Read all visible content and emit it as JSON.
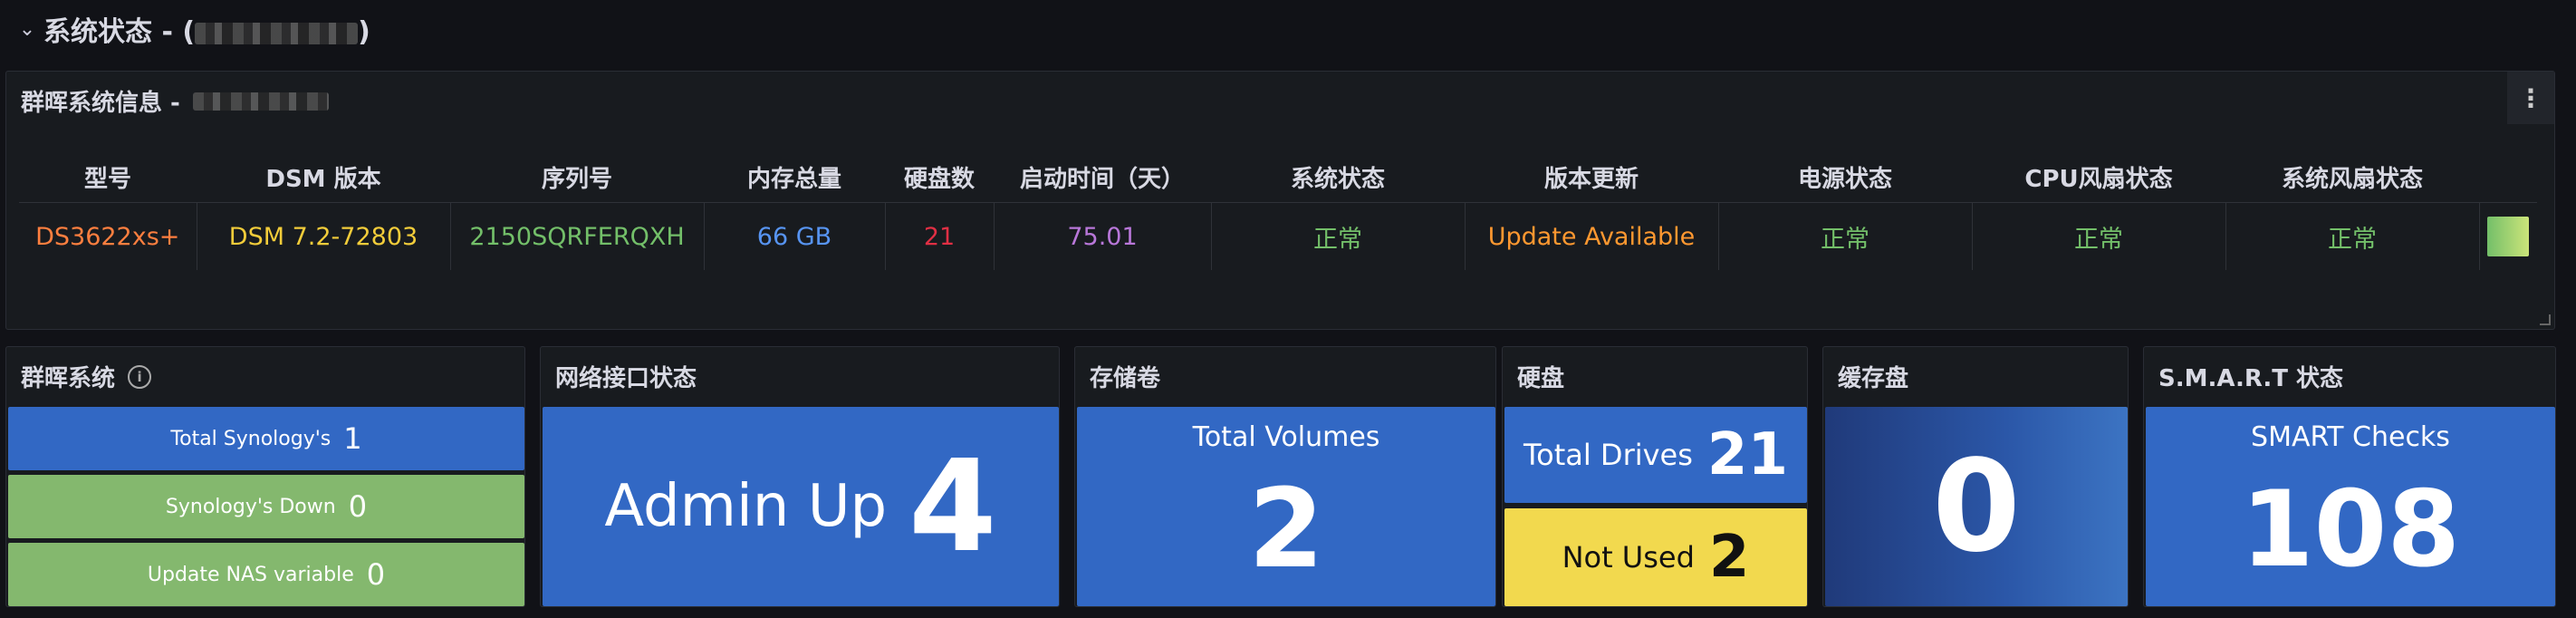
{
  "row": {
    "title": "系统状态 - (",
    "title_suffix": ")"
  },
  "info_panel": {
    "title": "群晖系统信息 - ",
    "columns": [
      "型号",
      "DSM 版本",
      "序列号",
      "内存总量",
      "硬盘数",
      "启动时间（天）",
      "系统状态",
      "版本更新",
      "电源状态",
      "CPU风扇状态",
      "系统风扇状态",
      ""
    ],
    "row": [
      "DS3622xs+",
      "DSM 7.2-72803",
      "2150SQRFERQXH",
      "66 GB",
      "21",
      "75.01",
      "正常",
      "Update Available",
      "正常",
      "正常",
      "正常"
    ],
    "cell_colors": [
      "#ff7f3f",
      "#f2cc3a",
      "#73bf69",
      "#5794f2",
      "#e02f44",
      "#b877d9",
      "#73bf69",
      "#ff9830",
      "#73bf69",
      "#73bf69",
      "#73bf69"
    ]
  },
  "synology_panel": {
    "title": "群晖系统",
    "items": [
      {
        "label": "Total Synology's",
        "value": "1"
      },
      {
        "label": "Synology's Down",
        "value": "0"
      },
      {
        "label": "Update NAS variable",
        "value": "0"
      }
    ]
  },
  "network_panel": {
    "title": "网络接口状态",
    "label": "Admin Up",
    "value": "4"
  },
  "volumes_panel": {
    "title": "存储卷",
    "label": "Total Volumes",
    "value": "2"
  },
  "disks_panel": {
    "title": "硬盘",
    "total_label": "Total Drives",
    "total_value": "21",
    "unused_label": "Not Used",
    "unused_value": "2"
  },
  "cache_panel": {
    "title": "缓存盘",
    "value": "0"
  },
  "smart_panel": {
    "title": "S.M.A.R.T 状态",
    "label": "SMART Checks",
    "value": "108"
  }
}
